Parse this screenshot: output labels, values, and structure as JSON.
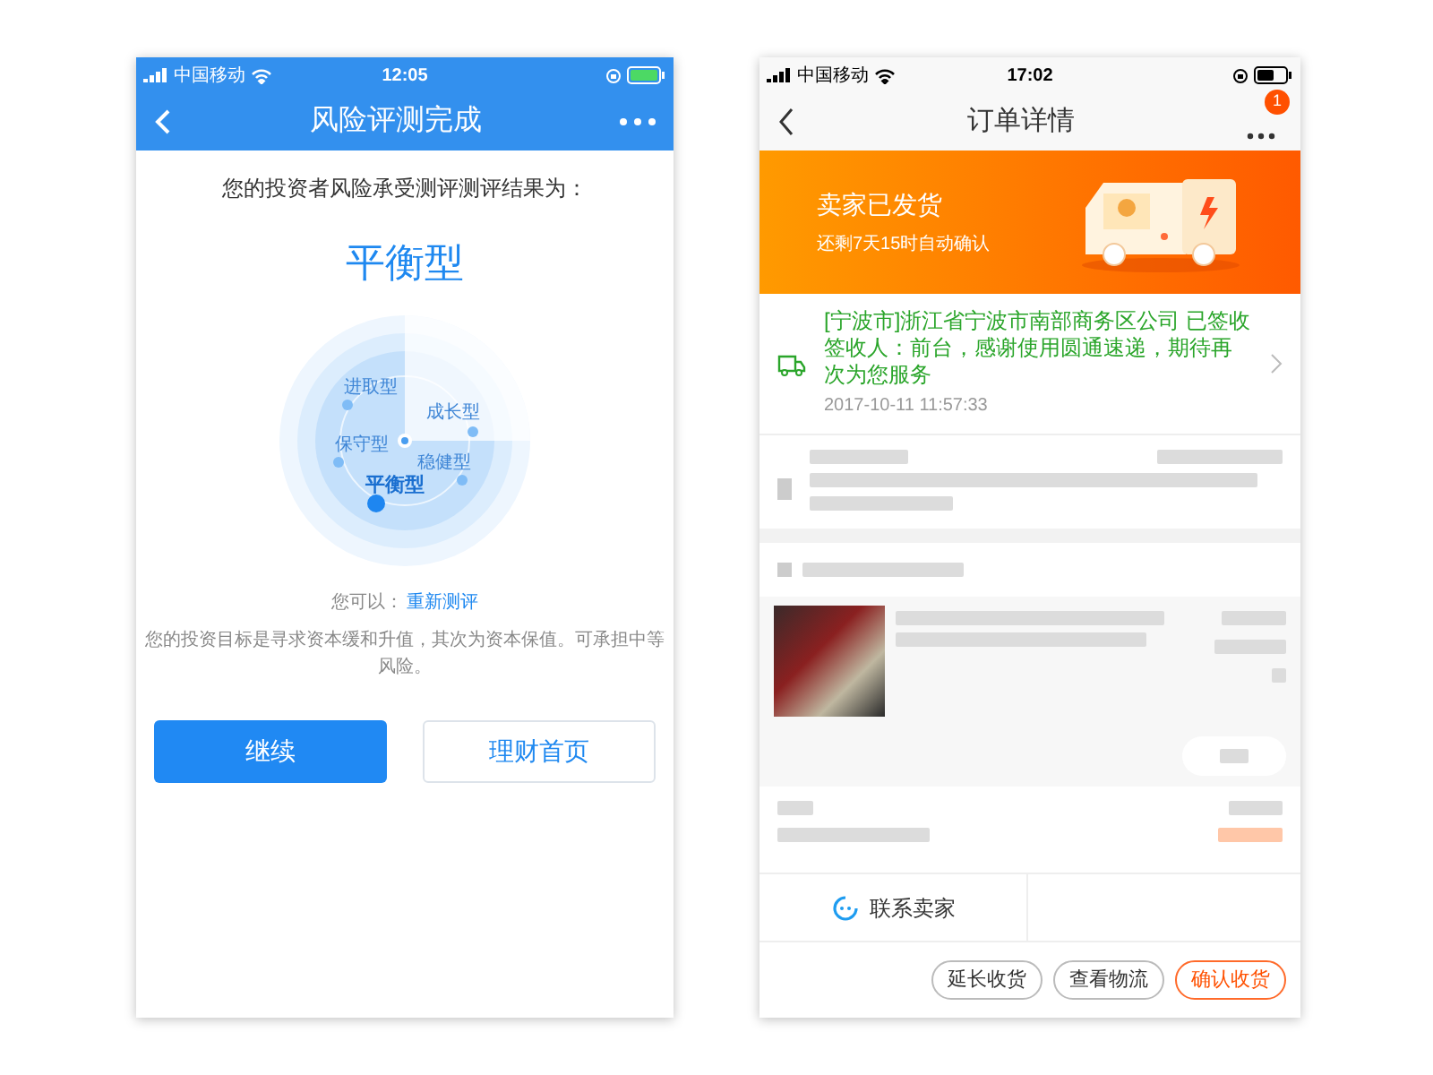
{
  "left_phone": {
    "status_bar": {
      "carrier": "中国移动",
      "time": "12:05"
    },
    "nav": {
      "title": "风险评测完成"
    },
    "intro": "您的投资者风险承受测评测评结果为：",
    "result": "平衡型",
    "radar_types": [
      {
        "label": "进取型",
        "selected": false
      },
      {
        "label": "成长型",
        "selected": false
      },
      {
        "label": "保守型",
        "selected": false
      },
      {
        "label": "稳健型",
        "selected": false
      },
      {
        "label": "平衡型",
        "selected": true
      }
    ],
    "retest_prompt": "您可以：",
    "retest_link": "重新测评",
    "description": "您的投资目标是寻求资本缓和升值，其次为资本保值。可承担中等风险。",
    "buttons": [
      {
        "label": "继续",
        "kind": "primary"
      },
      {
        "label": "理财首页",
        "kind": "secondary"
      }
    ]
  },
  "right_phone": {
    "status_bar": {
      "carrier": "中国移动",
      "time": "17:02"
    },
    "nav": {
      "title": "订单详情",
      "badge": "1"
    },
    "banner": {
      "title": "卖家已发货",
      "subtitle": "还剩7天15时自动确认"
    },
    "logistics": {
      "lines": [
        "[宁波市]浙江省宁波市南部商务区公司 已签收",
        "签收人：前台，感谢使用圆通速递，期待再次为您服务"
      ],
      "time": "2017-10-11 11:57:33"
    },
    "contact": "联系卖家",
    "buttons": [
      {
        "label": "延长收货",
        "kind": "secondary"
      },
      {
        "label": "查看物流",
        "kind": "secondary"
      },
      {
        "label": "确认收货",
        "kind": "primary"
      }
    ]
  }
}
